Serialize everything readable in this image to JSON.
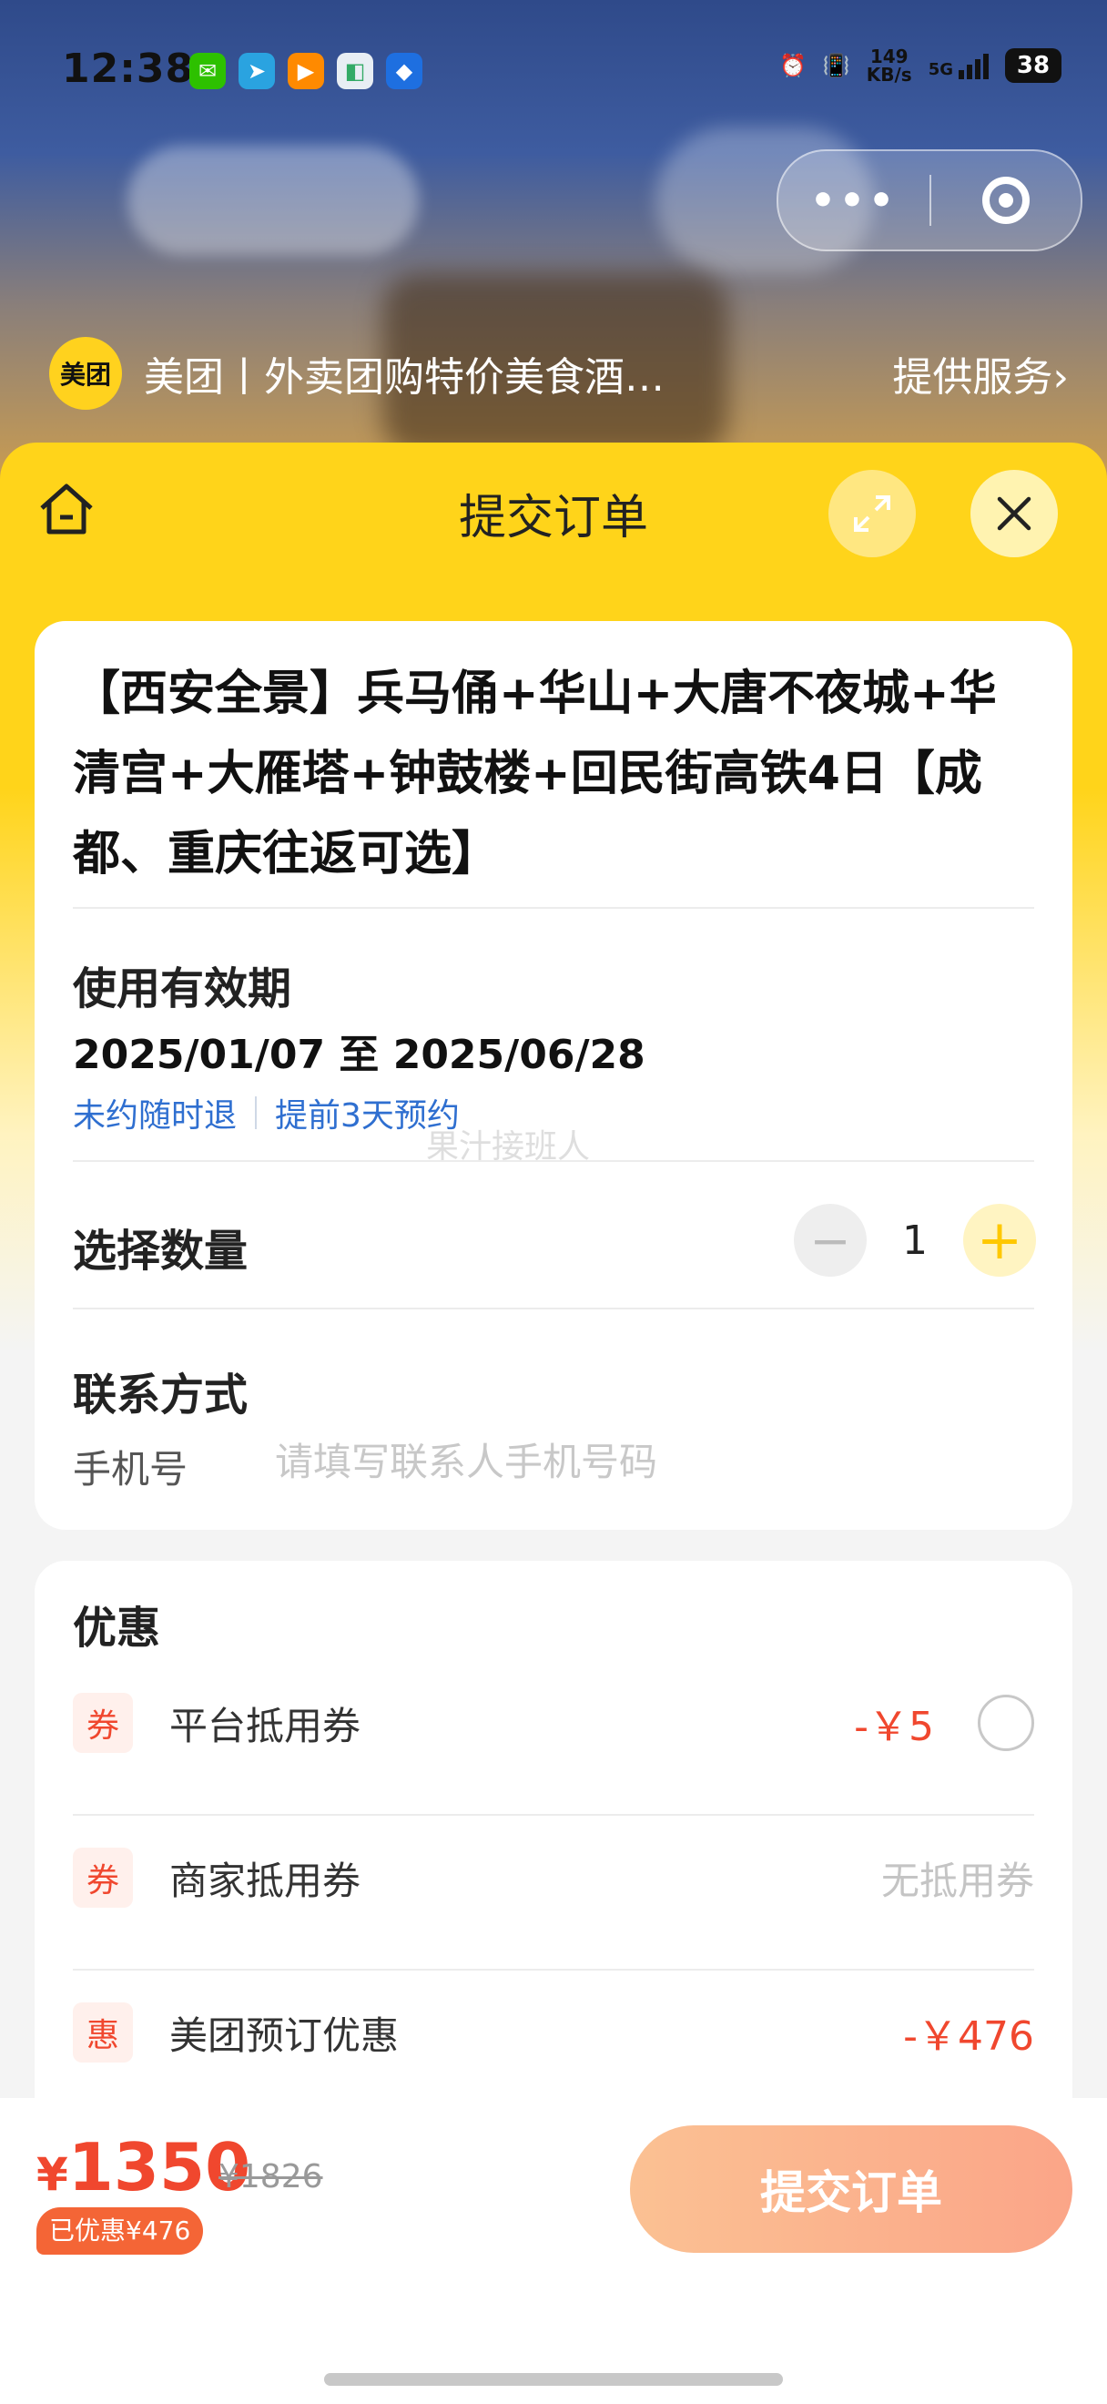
{
  "status_bar": {
    "time": "12:38",
    "net_speed": "149",
    "net_unit": "KB/s",
    "net_type": "5G",
    "battery": "38"
  },
  "capsule": {
    "more_label": "•••"
  },
  "provider": {
    "logo_text": "美团",
    "name": "美团丨外卖团购特价美食酒…",
    "service_label": "提供服务›"
  },
  "header": {
    "title": "提交订单",
    "expand_icon": "expand-icon",
    "close_icon": "close-icon",
    "home_icon": "home-icon"
  },
  "product": {
    "title": "【西安全景】兵马俑+华山+大唐不夜城+华清宫+大雁塔+钟鼓楼+回民街高铁4日【成都、重庆往返可选】",
    "validity_label": "使用有效期",
    "validity_range": "2025/01/07 至 2025/06/28",
    "tags": [
      "未约随时退",
      "提前3天预约"
    ],
    "watermark": "果汁接班人"
  },
  "quantity": {
    "label": "选择数量",
    "value": "1",
    "minus": "−",
    "plus": "+"
  },
  "contact": {
    "label": "联系方式",
    "phone_label": "手机号",
    "phone_placeholder": "请填写联系人手机号码",
    "phone_value": ""
  },
  "discounts": {
    "title": "优惠",
    "items": [
      {
        "badge": "券",
        "label": "平台抵用券",
        "value": "-￥5"
      },
      {
        "badge": "券",
        "label": "商家抵用券",
        "value": "无抵用券"
      },
      {
        "badge": "惠",
        "label": "美团预订优惠",
        "value": "-￥476"
      }
    ]
  },
  "checkout": {
    "currency": "¥",
    "price": "1350",
    "original_price": "¥1826",
    "saved": "已优惠¥476",
    "submit_label": "提交订单"
  },
  "colors": {
    "brand_yellow": "#ffd41a",
    "discount_red": "#f0472e",
    "link_blue": "#2f6fd0",
    "submit_gradient_start": "#fbc193",
    "submit_gradient_end": "#fba588"
  }
}
